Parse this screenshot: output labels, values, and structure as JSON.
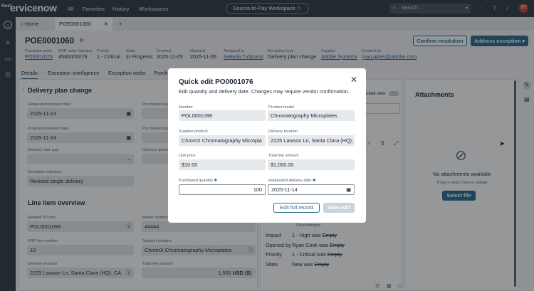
{
  "topbar": {
    "next_badge": "Next",
    "logo": "ervicenow",
    "nav": [
      "All",
      "Favorites",
      "History",
      "Workspaces"
    ],
    "workspace_pill": "Source-to-Pay Workspace",
    "search_placeholder": "Search",
    "avatar_initials": "ST"
  },
  "tabs": {
    "home": "Home",
    "record": "POE0001060"
  },
  "record": {
    "title": "POE0001060",
    "fields": [
      {
        "label": "Purchase order",
        "value": "PO0001076"
      },
      {
        "label": "ERP order Number",
        "value": "4500000076"
      },
      {
        "label": "Priority",
        "value": "1 - Critical"
      },
      {
        "label": "State",
        "value": "In Progress"
      },
      {
        "label": "Created",
        "value": "2025-11-05"
      },
      {
        "label": "Updated",
        "value": "2025-11-05"
      },
      {
        "label": "Assigned to",
        "value": "Selenia Tuttisanti"
      },
      {
        "label": "Exception type",
        "value": "Delivery plan change"
      },
      {
        "label": "Supplier",
        "value": "Adobe Systems"
      },
      {
        "label": "Created by",
        "value": "ryan.giges@adobe.com"
      }
    ],
    "confirm_button": "Confirm resolution",
    "address_button": "Address exception"
  },
  "subtabs": [
    "Details",
    "Exception intelligence",
    "Exception tasks",
    "Purch"
  ],
  "left": {
    "section1": "Delivery plan change",
    "req_delivery_label": "Requested delivery date",
    "req_delivery_value": "2025-11-14",
    "prop_delivery_label": "Proposed delivery date",
    "prop_delivery_value": "2025-11-24",
    "gap_label": "Delivery date gap",
    "purch_qty_label": "Purchased quan",
    "delivery_qty_label": "Delivery quanti",
    "subtype_label": "Exception sub-type",
    "subtype_value": "Revised single delivery",
    "section2": "Line item overview",
    "po_line_label": "Related PO line",
    "po_line_value": "POL0001098",
    "model_num_label": "Model number",
    "model_num_value": "44444",
    "erp_line_label": "ERP line number",
    "erp_line_value": "10",
    "supplier_product_label": "Supplier product",
    "supplier_product_value": "ChromX Chromatography Microplates",
    "delivery_loc_label": "Delivery location",
    "delivery_loc_value": "2225 Lawson Ln, Santa Clara (HQ), CA",
    "total_line_label": "Total line amount",
    "total_line_value": "1,000",
    "total_line_currency": "USD ($)"
  },
  "middle": {
    "tracked_view": "Tracked view",
    "field_changes_prefix": "Field changes",
    "activity": [
      {
        "label": "Impact",
        "value": "1 - High",
        "was": "was",
        "old": "Empty"
      },
      {
        "label": "Opened by",
        "value": "Ryan Cook",
        "was": "was",
        "old": "Empty"
      },
      {
        "label": "Priority",
        "value": "1 - Critical",
        "was": "was",
        "old": "Empty"
      },
      {
        "label": "State",
        "value": "New",
        "was": "was",
        "old": "Empty"
      }
    ]
  },
  "attachments": {
    "title": "Attachments",
    "empty": "No attachments available",
    "hint": "Drag or select files to upload",
    "select_button": "Select file"
  },
  "modal": {
    "title": "Quick edit PO0001076",
    "subtitle": "Edit quantity and delivery date. Changes may require vendor confirmation.",
    "number_label": "Number",
    "number_value": "POL0001098",
    "model_label": "Product model",
    "model_value": "Chromatography Microplates",
    "supplier_product_label": "Supplier product",
    "supplier_product_value": "ChromX Chromatography Micropla",
    "location_label": "Delivery location",
    "location_value": "2225 Lawson Ln, Santa Clara (HQ),",
    "unit_price_label": "Unit price",
    "unit_price_value": "$10.00",
    "total_label": "Total line amount",
    "total_value": "$1,000.00",
    "qty_label": "Purchased quantity",
    "qty_value": "100",
    "req_date_label": "Requested delivery date",
    "req_date_value": "2025-11-14",
    "edit_full_button": "Edit full record",
    "save_button": "Save edit"
  },
  "colors": {
    "accent": "#2b6a8f",
    "nav_bg": "#2f3841",
    "required": "#1f5f9e"
  }
}
